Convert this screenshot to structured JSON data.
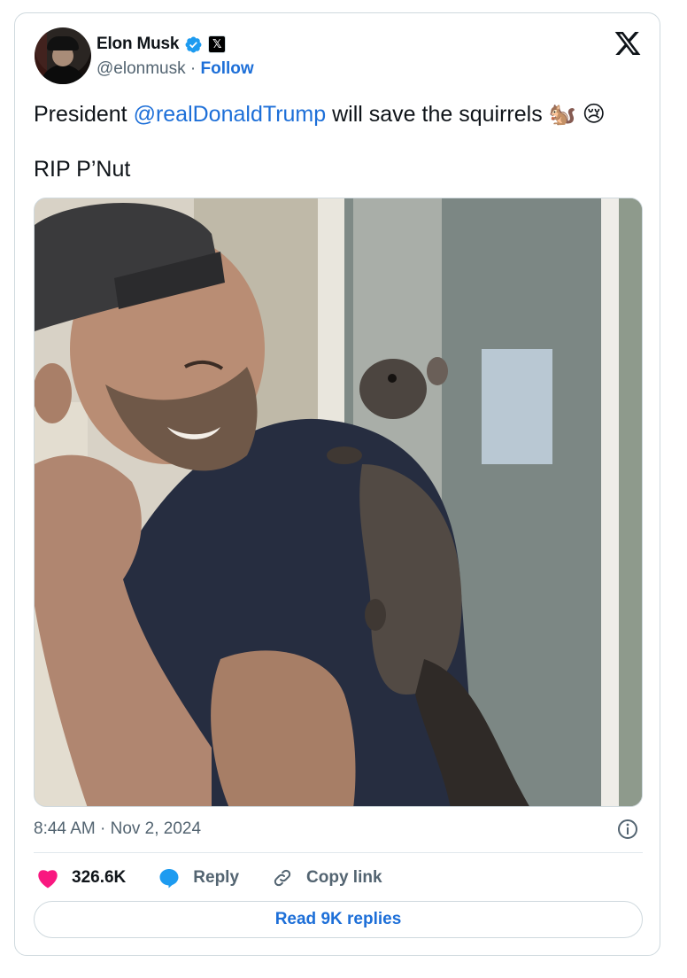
{
  "author": {
    "name": "Elon Musk",
    "handle": "@elonmusk",
    "separator": "·",
    "follow_label": "Follow"
  },
  "tweet": {
    "text_prefix": "President ",
    "mention": "@realDonaldTrump",
    "text_suffix": " will save the squirrels 🐿️ 😢",
    "line2": "RIP P’Nut"
  },
  "timestamp": "8:44 AM · Nov 2, 2024",
  "actions": {
    "likes": "326.6K",
    "reply": "Reply",
    "copy_link": "Copy link"
  },
  "read_replies": "Read 9K replies",
  "colors": {
    "accent": "#1d6fd8",
    "like": "#f91880",
    "reply_icon": "#1d9bf0",
    "muted": "#536471",
    "border": "#cfd9de"
  },
  "icons": [
    "verified-badge-icon",
    "x-affiliate-icon",
    "x-logo-icon",
    "info-icon",
    "heart-icon",
    "reply-bubble-icon",
    "link-icon"
  ]
}
